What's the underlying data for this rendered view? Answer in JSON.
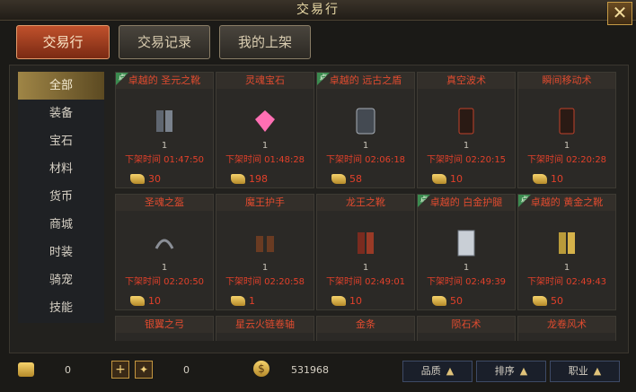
{
  "window": {
    "title": "交易行"
  },
  "tabs": [
    {
      "label": "交易行"
    },
    {
      "label": "交易记录"
    },
    {
      "label": "我的上架"
    }
  ],
  "sidebar": {
    "items": [
      "全部",
      "装备",
      "宝石",
      "材料",
      "货币",
      "商城",
      "时装",
      "骑宠",
      "技能"
    ],
    "active_index": 0
  },
  "grid": {
    "row1": [
      {
        "name": "卓越的 圣元之靴",
        "qty": "1",
        "time": "下架时间 01:47:50",
        "price": "30",
        "badge": true
      },
      {
        "name": "灵魂宝石",
        "qty": "1",
        "time": "下架时间 01:48:28",
        "price": "198",
        "badge": false
      },
      {
        "name": "卓越的 远古之盾",
        "qty": "1",
        "time": "下架时间 02:06:18",
        "price": "58",
        "badge": true
      },
      {
        "name": "真空波术",
        "qty": "1",
        "time": "下架时间 02:20:15",
        "price": "10",
        "badge": false
      },
      {
        "name": "瞬间移动术",
        "qty": "1",
        "time": "下架时间 02:20:28",
        "price": "10",
        "badge": false
      }
    ],
    "row2": [
      {
        "name": "圣魂之盔",
        "qty": "1",
        "time": "下架时间 02:20:50",
        "price": "10",
        "badge": false
      },
      {
        "name": "魔王护手",
        "qty": "1",
        "time": "下架时间 02:20:58",
        "price": "1",
        "badge": false
      },
      {
        "name": "龙王之靴",
        "qty": "1",
        "time": "下架时间 02:49:01",
        "price": "10",
        "badge": false
      },
      {
        "name": "卓越的 白金护腿",
        "qty": "1",
        "time": "下架时间 02:49:39",
        "price": "50",
        "badge": true
      },
      {
        "name": "卓越的 黄金之靴",
        "qty": "1",
        "time": "下架时间 02:49:43",
        "price": "50",
        "badge": true
      }
    ],
    "row3": [
      {
        "name": "银翼之弓"
      },
      {
        "name": "星云火链卷轴"
      },
      {
        "name": "金条"
      },
      {
        "name": "陨石术"
      },
      {
        "name": "龙卷风术"
      }
    ]
  },
  "bottom": {
    "coin_count": "0",
    "pet_count": "0",
    "gold": "531968",
    "buttons": [
      {
        "label": "品质"
      },
      {
        "label": "排序"
      },
      {
        "label": "职业"
      }
    ]
  },
  "icons": [
    "close-icon",
    "coin-icon",
    "add-icon",
    "pet-icon",
    "gold-icon",
    "arrow-up-icon"
  ]
}
